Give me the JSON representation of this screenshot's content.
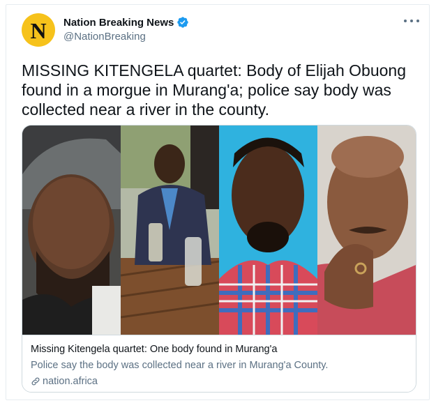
{
  "account": {
    "display_name": "Nation Breaking News",
    "handle": "@NationBreaking",
    "avatar_letter": "N",
    "avatar_color": "#f6c21b",
    "verified": true
  },
  "tweet": {
    "text": "MISSING KITENGELA quartet: Body of Elijah Obuong found in a morgue in Murang'a; police say body was collected near a river in the county."
  },
  "link_card": {
    "title": "Missing Kitengela quartet: One body found in Murang'a",
    "description": "Police say the body was collected near a river in Murang'a County.",
    "domain": "nation.africa",
    "image_panels": [
      "portrait-1",
      "portrait-2",
      "portrait-3",
      "portrait-4"
    ]
  },
  "colors": {
    "accent": "#1d9bf0",
    "secondary_text": "#5b7083",
    "border": "#cfd9de"
  },
  "icons": [
    "verified-badge-icon",
    "more-options-icon",
    "link-icon"
  ]
}
